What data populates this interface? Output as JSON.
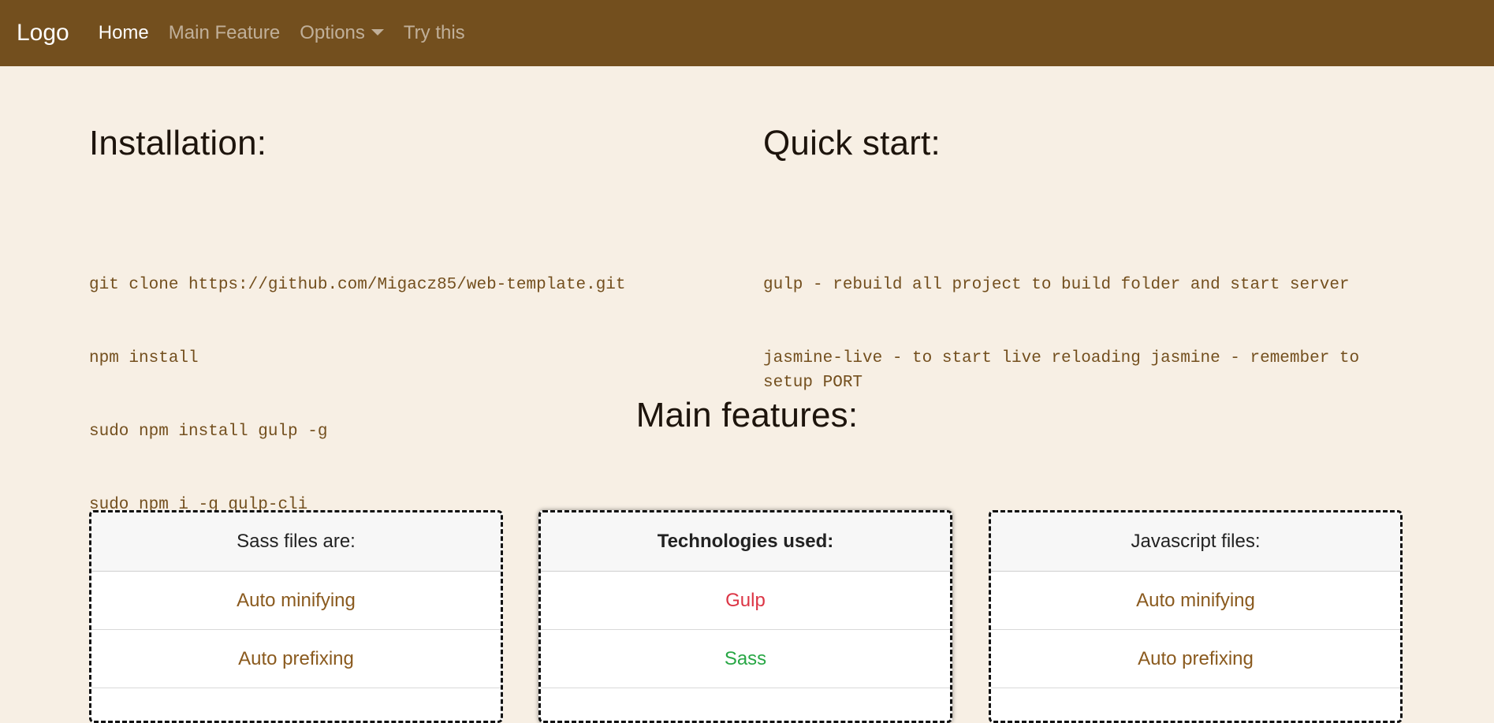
{
  "navbar": {
    "brand": "Logo",
    "items": [
      {
        "label": "Home",
        "active": true
      },
      {
        "label": "Main Feature",
        "active": false
      },
      {
        "label": "Options",
        "active": false,
        "dropdown": true
      },
      {
        "label": "Try this",
        "active": false
      }
    ],
    "colors": {
      "background": "#734f1e"
    }
  },
  "installation": {
    "title": "Installation:",
    "lines": [
      "git clone https://github.com/Migacz85/web-template.git",
      "npm install",
      "sudo npm install gulp -g",
      "sudo npm i -g gulp-cli"
    ]
  },
  "quick_start": {
    "title": "Quick start:",
    "lines": [
      "gulp - rebuild all project to build folder and start server",
      "jasmine-live - to start live reloading jasmine - remember to setup PORT"
    ]
  },
  "features": {
    "title": "Main features:",
    "cards": [
      {
        "header": "Sass files are:",
        "items": [
          {
            "label": "Auto minifying",
            "color": "#8a5a1e"
          },
          {
            "label": "Auto prefixing",
            "color": "#8a5a1e"
          }
        ]
      },
      {
        "header": "Technologies used:",
        "items": [
          {
            "label": "Gulp",
            "color": "#dc3545"
          },
          {
            "label": "Sass",
            "color": "#28a745"
          }
        ]
      },
      {
        "header": "Javascript files:",
        "items": [
          {
            "label": "Auto minifying",
            "color": "#8a5a1e"
          },
          {
            "label": "Auto prefixing",
            "color": "#8a5a1e"
          }
        ]
      }
    ]
  }
}
